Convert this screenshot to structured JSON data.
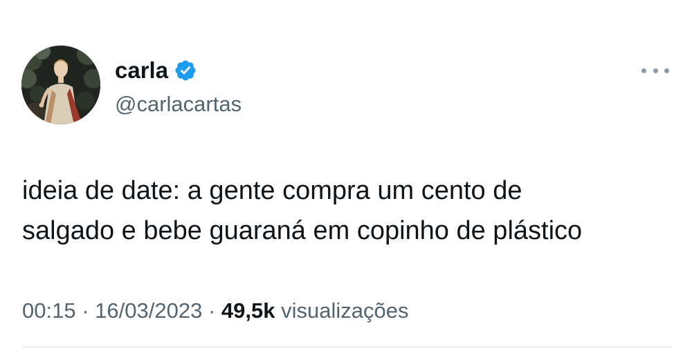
{
  "author": {
    "display_name": "carla",
    "handle": "@carlacartas",
    "verified": true
  },
  "tweet": {
    "text": "ideia de date: a gente compra um cento de\nsalgado e bebe guaraná em copinho de plástico",
    "time": "00:15",
    "separator": "·",
    "date": "16/03/2023",
    "views_count": "49,5k",
    "views_label": "visualizações"
  },
  "icons": {
    "avatar": "avatar-renaissance-painting-icon",
    "verified": "verified-badge-icon",
    "more": "more-options-icon"
  },
  "colors": {
    "text": "#0f1419",
    "muted": "#536471",
    "verified_blue": "#1d9bf0",
    "divider": "#d8dfe4"
  }
}
